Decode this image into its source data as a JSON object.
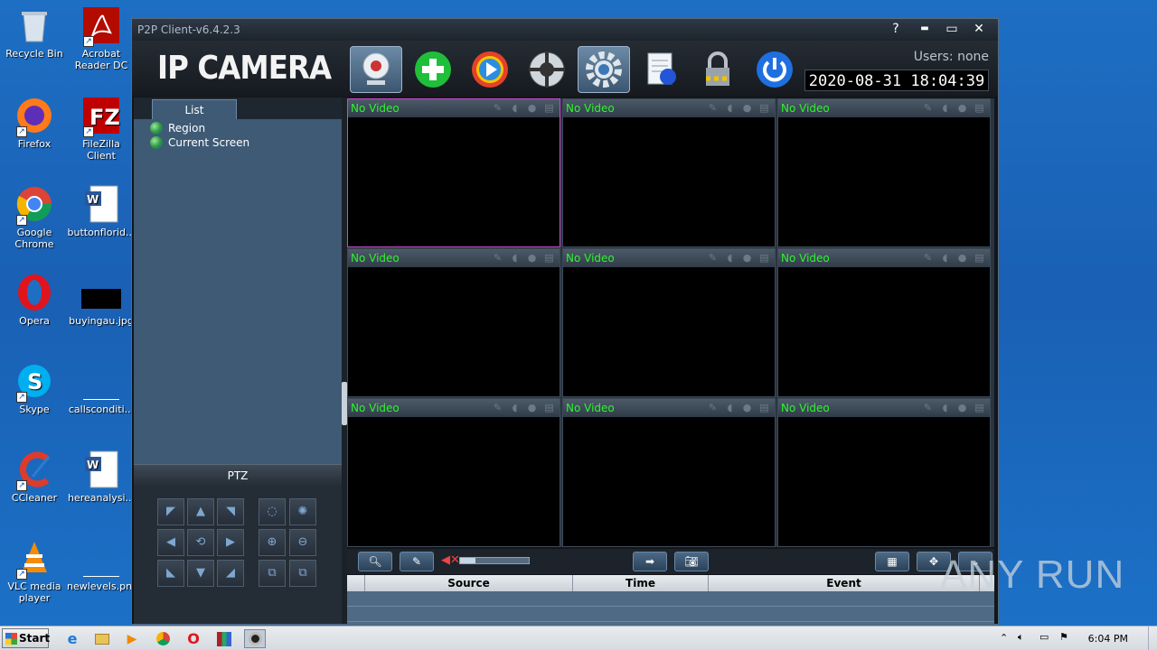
{
  "desktop": {
    "icons": [
      {
        "label": "Recycle Bin"
      },
      {
        "label": "Acrobat Reader DC"
      },
      {
        "label": "Firefox"
      },
      {
        "label": "FileZilla Client"
      },
      {
        "label": "Google Chrome"
      },
      {
        "label": "buttonflorid..."
      },
      {
        "label": "Opera"
      },
      {
        "label": "buyingau.jpg"
      },
      {
        "label": "Skype"
      },
      {
        "label": "callsconditi..."
      },
      {
        "label": "CCleaner"
      },
      {
        "label": "hereanalysi..."
      },
      {
        "label": "VLC media player"
      },
      {
        "label": "newlevels.png"
      }
    ]
  },
  "window": {
    "title": "P2P Client-v6.4.2.3",
    "controls": {
      "help": "?",
      "minimize": "▬",
      "maximize": "▭",
      "close": "✕"
    }
  },
  "header": {
    "brand": "IP CAMERA",
    "users": "Users: none",
    "datetime": "2020-08-31  18:04:39",
    "tools": [
      {
        "icon": "webcam-icon",
        "active": true
      },
      {
        "icon": "add-icon",
        "active": false
      },
      {
        "icon": "playback-icon",
        "active": false
      },
      {
        "icon": "ptz-wheel-icon",
        "active": false
      },
      {
        "icon": "settings-gear-icon",
        "active": true
      },
      {
        "icon": "log-icon",
        "active": false
      },
      {
        "icon": "lock-icon",
        "active": false
      },
      {
        "icon": "power-icon",
        "active": false
      }
    ]
  },
  "left_panel": {
    "tab": "List",
    "tree": [
      "Region",
      "Current Screen"
    ],
    "ptz_title": "PTZ"
  },
  "video_grid": {
    "cells": [
      {
        "label": "No Video",
        "selected": true
      },
      {
        "label": "No Video",
        "selected": false
      },
      {
        "label": "No Video",
        "selected": false
      },
      {
        "label": "No Video",
        "selected": false
      },
      {
        "label": "No Video",
        "selected": false
      },
      {
        "label": "No Video",
        "selected": false
      },
      {
        "label": "No Video",
        "selected": false
      },
      {
        "label": "No Video",
        "selected": false
      },
      {
        "label": "No Video",
        "selected": false
      }
    ]
  },
  "events_table": {
    "columns": [
      "Source",
      "Time",
      "Event"
    ]
  },
  "taskbar": {
    "start": "Start",
    "time": "6:04 PM"
  },
  "watermark": "ANY RUN",
  "colors": {
    "accent_green": "#2cf52c",
    "selected_border": "#c94acb",
    "desktop_blue": "#1d6fc4"
  }
}
